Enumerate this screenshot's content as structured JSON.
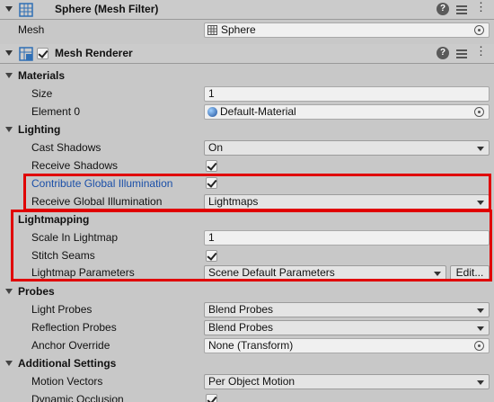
{
  "mesh_filter": {
    "title": "Sphere (Mesh Filter)",
    "mesh_label": "Mesh",
    "mesh_value": "Sphere"
  },
  "mesh_renderer": {
    "title": "Mesh Renderer",
    "enabled": true
  },
  "materials": {
    "header": "Materials",
    "size_label": "Size",
    "size_value": "1",
    "element0_label": "Element 0",
    "element0_value": "Default-Material"
  },
  "lighting": {
    "header": "Lighting",
    "cast_shadows_label": "Cast Shadows",
    "cast_shadows_value": "On",
    "receive_shadows_label": "Receive Shadows",
    "receive_shadows_checked": true,
    "contribute_gi_label": "Contribute Global Illumination",
    "contribute_gi_checked": true,
    "receive_gi_label": "Receive Global Illumination",
    "receive_gi_value": "Lightmaps"
  },
  "lightmapping": {
    "header": "Lightmapping",
    "scale_label": "Scale In Lightmap",
    "scale_value": "1",
    "stitch_label": "Stitch Seams",
    "stitch_checked": true,
    "params_label": "Lightmap Parameters",
    "params_value": "Scene Default Parameters",
    "edit_label": "Edit..."
  },
  "probes": {
    "header": "Probes",
    "light_probes_label": "Light Probes",
    "light_probes_value": "Blend Probes",
    "reflection_probes_label": "Reflection Probes",
    "reflection_probes_value": "Blend Probes",
    "anchor_label": "Anchor Override",
    "anchor_value": "None (Transform)"
  },
  "additional": {
    "header": "Additional Settings",
    "motion_label": "Motion Vectors",
    "motion_value": "Per Object Motion",
    "occlusion_label": "Dynamic Occlusion",
    "occlusion_checked": true
  },
  "colors": {
    "highlight": "#e00000",
    "link_blue": "#1a4fa8",
    "background": "#c8c8c8"
  },
  "icons": [
    "mesh-filter-icon",
    "mesh-renderer-icon",
    "help-icon",
    "preset-icon",
    "menu-icon",
    "object-picker-icon",
    "material-sphere-icon",
    "mesh-small-icon"
  ]
}
